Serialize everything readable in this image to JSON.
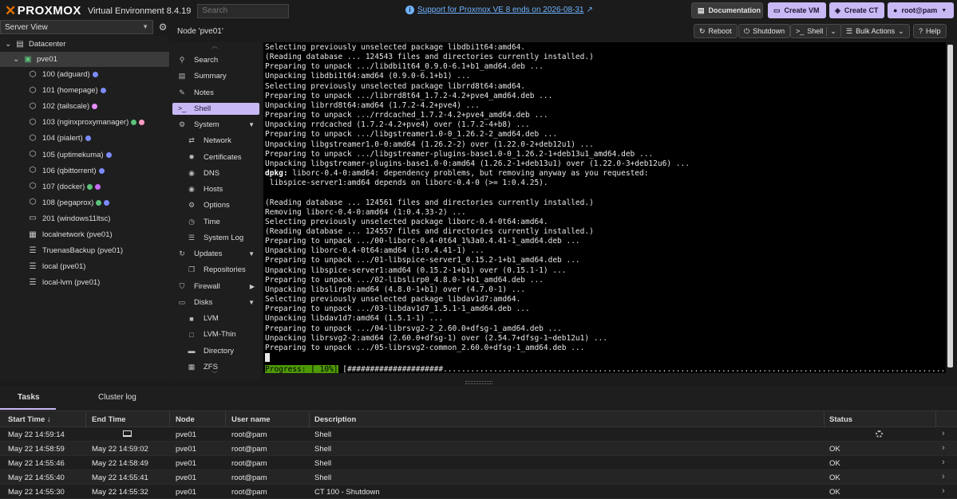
{
  "header": {
    "product": "PROXMOX",
    "version": "Virtual Environment 8.4.19",
    "search_placeholder": "Search",
    "support_link": "Support for Proxmox VE 8 ends on 2026-08-31",
    "documentation_label": "Documentation",
    "create_vm_label": "Create VM",
    "create_ct_label": "Create CT",
    "user_label": "root@pam"
  },
  "view_selector": "Server View",
  "tree": {
    "datacenter": "Datacenter",
    "node": "pve01",
    "items": [
      {
        "label": "100 (adguard)",
        "dots": [
          "#7b8cff"
        ]
      },
      {
        "label": "101 (homepage)",
        "dots": [
          "#7b8cff"
        ]
      },
      {
        "label": "102 (tailscale)",
        "dots": [
          "#e58cff"
        ]
      },
      {
        "label": "103 (nginxproxymanager)",
        "dots": [
          "#5cc27a",
          "#ff9dc4"
        ]
      },
      {
        "label": "104 (pialert)",
        "dots": [
          "#7b8cff"
        ]
      },
      {
        "label": "105 (uptimekuma)",
        "dots": [
          "#7b8cff"
        ]
      },
      {
        "label": "106 (qbittorrent)",
        "dots": [
          "#7b8cff"
        ]
      },
      {
        "label": "107 (docker)",
        "dots": [
          "#5cc27a",
          "#c86bff"
        ]
      },
      {
        "label": "108 (pegaprox)",
        "dots": [
          "#5cc27a",
          "#7b8cff"
        ]
      },
      {
        "label": "201 (windows11ltsc)",
        "dots": []
      },
      {
        "label": "localnetwork (pve01)",
        "dots": []
      },
      {
        "label": "TruenasBackup (pve01)",
        "dots": []
      },
      {
        "label": "local (pve01)",
        "dots": []
      },
      {
        "label": "local-lvm (pve01)",
        "dots": []
      }
    ]
  },
  "node_title": "Node 'pve01'",
  "toolbar": {
    "reboot": "Reboot",
    "shutdown": "Shutdown",
    "shell": "Shell",
    "bulk_actions": "Bulk Actions",
    "help": "Help"
  },
  "nav": [
    {
      "label": "Search",
      "icon": "search-icon",
      "glyph": "⚲"
    },
    {
      "label": "Summary",
      "icon": "book-icon",
      "glyph": "▤"
    },
    {
      "label": "Notes",
      "icon": "notes-icon",
      "glyph": "✎"
    },
    {
      "label": "Shell",
      "icon": "terminal-icon",
      "glyph": ">_"
    },
    {
      "label": "System",
      "icon": "gears-icon",
      "glyph": "⚙"
    },
    {
      "label": "Network",
      "icon": "exchange-icon",
      "glyph": "⇄"
    },
    {
      "label": "Certificates",
      "icon": "certificate-icon",
      "glyph": "✹"
    },
    {
      "label": "DNS",
      "icon": "globe-icon",
      "glyph": "◉"
    },
    {
      "label": "Hosts",
      "icon": "globe-icon",
      "glyph": "◉"
    },
    {
      "label": "Options",
      "icon": "gear-icon",
      "glyph": "⚙"
    },
    {
      "label": "Time",
      "icon": "clock-icon",
      "glyph": "◷"
    },
    {
      "label": "System Log",
      "icon": "list-icon",
      "glyph": "☰"
    },
    {
      "label": "Updates",
      "icon": "refresh-icon",
      "glyph": "↻"
    },
    {
      "label": "Repositories",
      "icon": "files-icon",
      "glyph": "❐"
    },
    {
      "label": "Firewall",
      "icon": "shield-icon",
      "glyph": "⛉"
    },
    {
      "label": "Disks",
      "icon": "hdd-icon",
      "glyph": "▭"
    },
    {
      "label": "LVM",
      "icon": "square-icon",
      "glyph": "■"
    },
    {
      "label": "LVM-Thin",
      "icon": "square-outline-icon",
      "glyph": "□"
    },
    {
      "label": "Directory",
      "icon": "folder-icon",
      "glyph": "▬"
    },
    {
      "label": "ZFS",
      "icon": "th-large-icon",
      "glyph": "▦"
    }
  ],
  "terminal": {
    "lines": [
      "Selecting previously unselected package libdbi1t64:amd64.",
      "(Reading database ... 124543 files and directories currently installed.)",
      "Preparing to unpack .../libdbi1t64_0.9.0-6.1+b1_amd64.deb ...",
      "Unpacking libdbi1t64:amd64 (0.9.0-6.1+b1) ...",
      "Selecting previously unselected package librrd8t64:amd64.",
      "Preparing to unpack .../librrd8t64_1.7.2-4.2+pve4_amd64.deb ...",
      "Unpacking librrd8t64:amd64 (1.7.2-4.2+pve4) ...",
      "Preparing to unpack .../rrdcached_1.7.2-4.2+pve4_amd64.deb ...",
      "Unpacking rrdcached (1.7.2-4.2+pve4) over (1.7.2-4+b8) ...",
      "Preparing to unpack .../libgstreamer1.0-0_1.26.2-2_amd64.deb ...",
      "Unpacking libgstreamer1.0-0:amd64 (1.26.2-2) over (1.22.0-2+deb12u1) ...",
      "Preparing to unpack .../libgstreamer-plugins-base1.0-0_1.26.2-1+deb13u1_amd64.deb ...",
      "Unpacking libgstreamer-plugins-base1.0-0:amd64 (1.26.2-1+deb13u1) over (1.22.0-3+deb12u6) ...",
      "dpkg: liborc-0.4-0:amd64: dependency problems, but removing anyway as you requested:",
      " libspice-server1:amd64 depends on liborc-0.4-0 (>= 1:0.4.25).",
      "",
      "(Reading database ... 124561 files and directories currently installed.)",
      "Removing liborc-0.4-0:amd64 (1:0.4.33-2) ...",
      "Selecting previously unselected package liborc-0.4-0t64:amd64.",
      "(Reading database ... 124557 files and directories currently installed.)",
      "Preparing to unpack .../00-liborc-0.4-0t64_1%3a0.4.41-1_amd64.deb ...",
      "Unpacking liborc-0.4-0t64:amd64 (1:0.4.41-1) ...",
      "Preparing to unpack .../01-libspice-server1_0.15.2-1+b1_amd64.deb ...",
      "Unpacking libspice-server1:amd64 (0.15.2-1+b1) over (0.15.1-1) ...",
      "Preparing to unpack .../02-libslirp0_4.8.0-1+b1_amd64.deb ...",
      "Unpacking libslirp0:amd64 (4.8.0-1+b1) over (4.7.0-1) ...",
      "Selecting previously unselected package libdav1d7:amd64.",
      "Preparing to unpack .../03-libdav1d7_1.5.1-1_amd64.deb ...",
      "Unpacking libdav1d7:amd64 (1.5.1-1) ...",
      "Preparing to unpack .../04-librsvg2-2_2.60.0+dfsg-1_amd64.deb ...",
      "Unpacking librsvg2-2:amd64 (2.60.0+dfsg-1) over (2.54.7+dfsg-1~deb12u1) ...",
      "Preparing to unpack .../05-librsvg2-common_2.60.0+dfsg-1_amd64.deb ..."
    ],
    "progress_label": "Progress: [ 10%]",
    "progress_percent": 10,
    "progress_bar": " [#####################.................................................................................................................................]"
  },
  "tasks": {
    "tab_tasks": "Tasks",
    "tab_cluster_log": "Cluster log",
    "columns": [
      "Start Time ↓",
      "End Time",
      "Node",
      "User name",
      "Description",
      "Status"
    ],
    "rows": [
      {
        "start": "May 22 14:59:14",
        "end": "",
        "node": "pve01",
        "user": "root@pam",
        "desc": "Shell",
        "status": ""
      },
      {
        "start": "May 22 14:58:59",
        "end": "May 22 14:59:02",
        "node": "pve01",
        "user": "root@pam",
        "desc": "Shell",
        "status": "OK"
      },
      {
        "start": "May 22 14:55:46",
        "end": "May 22 14:58:49",
        "node": "pve01",
        "user": "root@pam",
        "desc": "Shell",
        "status": "OK"
      },
      {
        "start": "May 22 14:55:40",
        "end": "May 22 14:55:41",
        "node": "pve01",
        "user": "root@pam",
        "desc": "Shell",
        "status": "OK"
      },
      {
        "start": "May 22 14:55:30",
        "end": "May 22 14:55:32",
        "node": "pve01",
        "user": "root@pam",
        "desc": "CT 100 - Shutdown",
        "status": "OK"
      }
    ]
  }
}
